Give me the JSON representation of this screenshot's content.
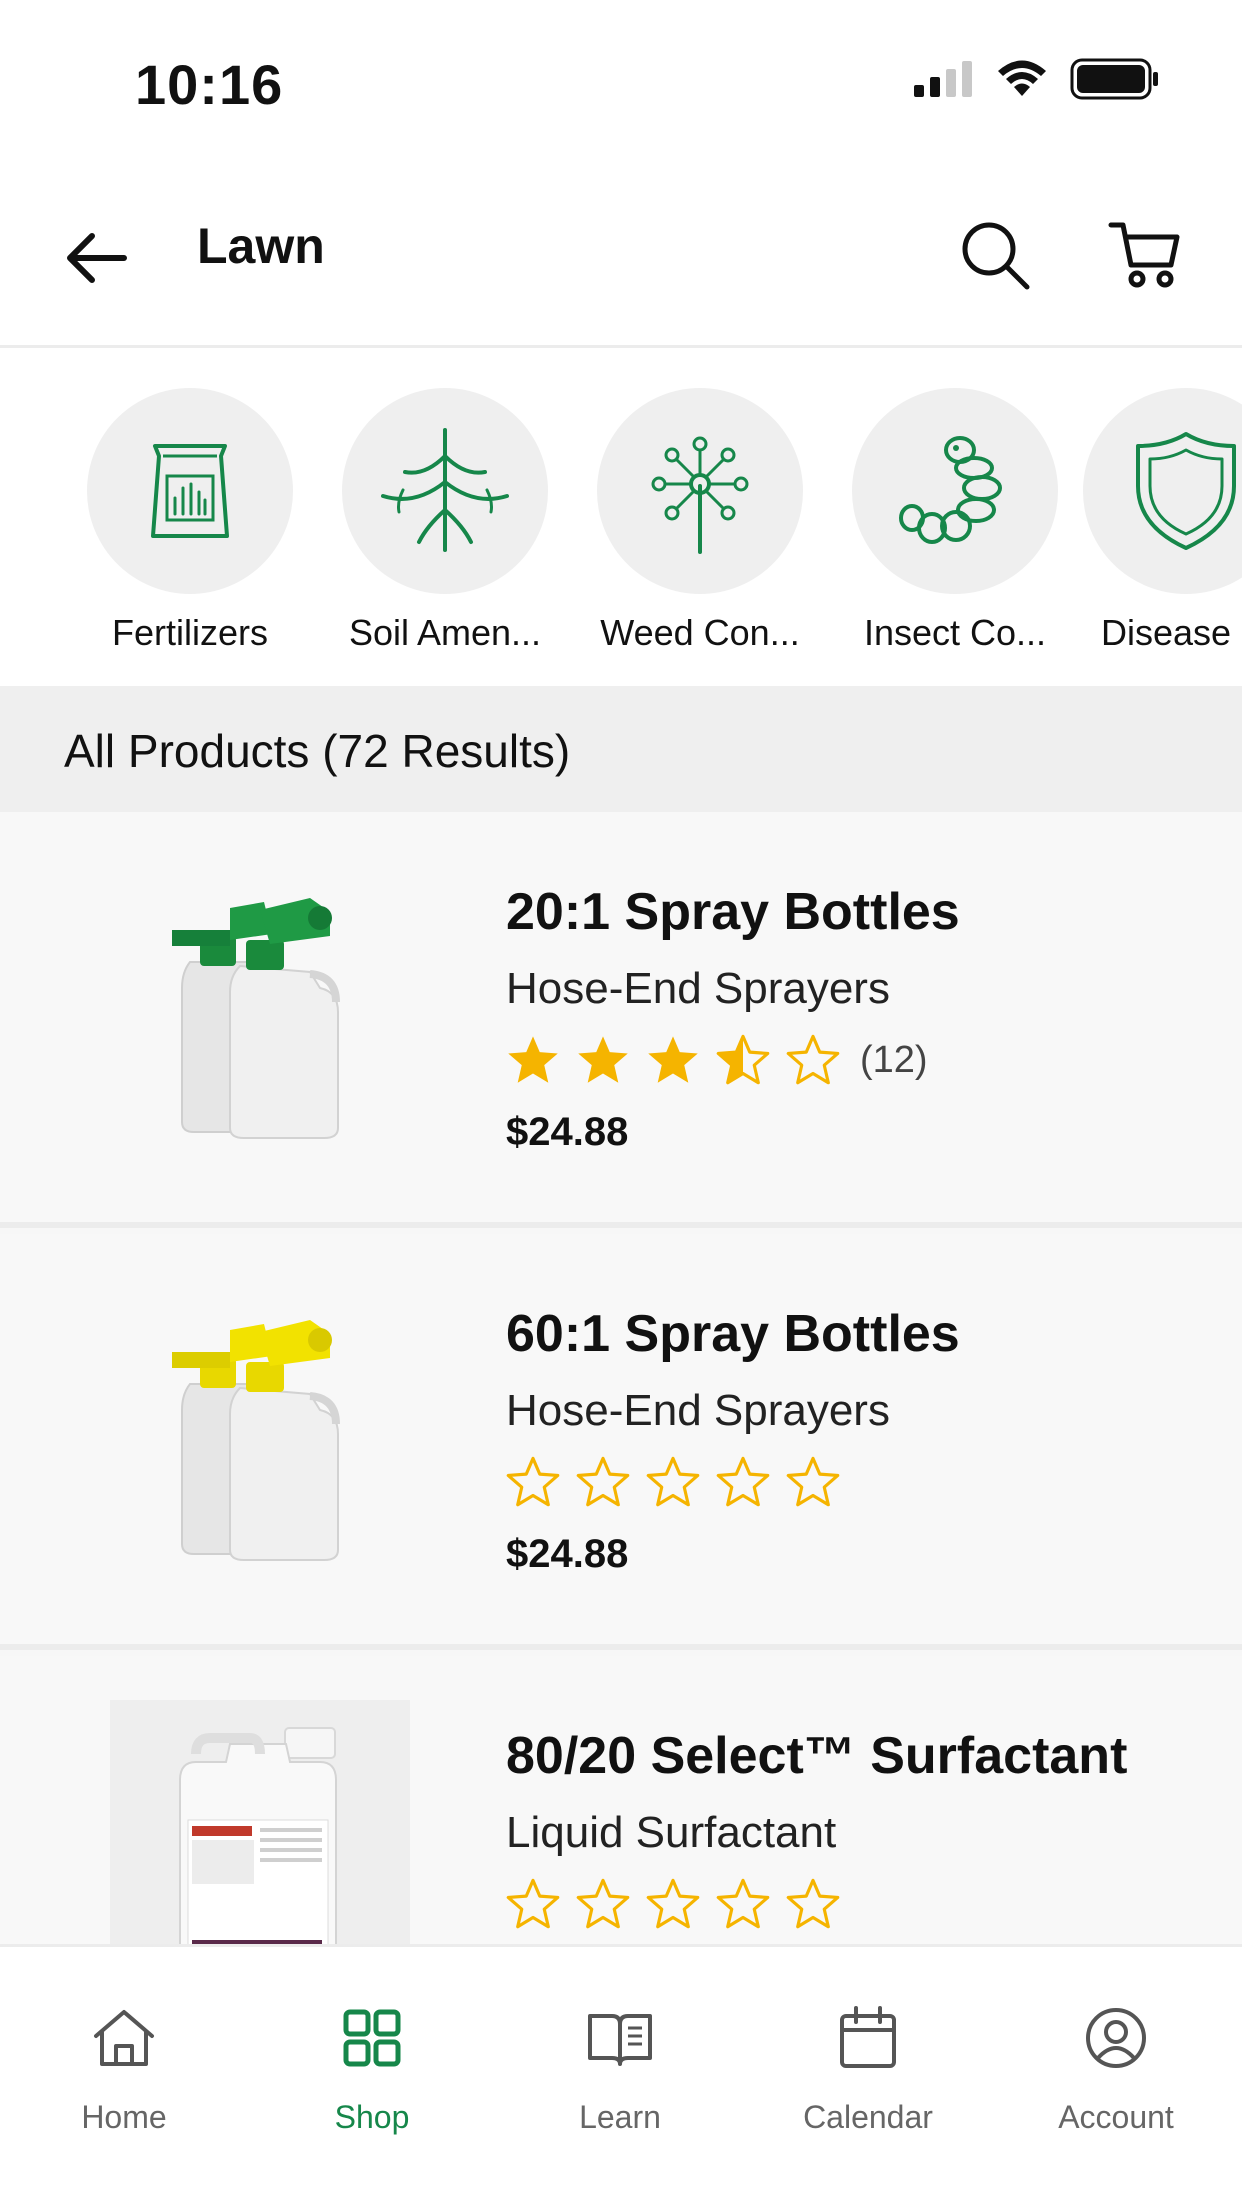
{
  "status_bar": {
    "time": "10:16"
  },
  "header": {
    "title": "Lawn"
  },
  "categories": [
    {
      "label": "Fertilizers",
      "icon": "fertilizer-bag-icon"
    },
    {
      "label": "Soil Amen...",
      "icon": "roots-icon"
    },
    {
      "label": "Weed Con...",
      "icon": "dandelion-icon"
    },
    {
      "label": "Insect Co...",
      "icon": "grub-icon"
    },
    {
      "label": "Disease",
      "icon": "shield-icon"
    }
  ],
  "results": {
    "label": "All Products (72 Results)"
  },
  "products": [
    {
      "name": "20:1 Spray Bottles",
      "subtitle": "Hose-End Sprayers",
      "rating": 3.5,
      "reviews": "(12)",
      "price": "$24.88",
      "nozzle_color": "#1a8a3c"
    },
    {
      "name": "60:1 Spray Bottles",
      "subtitle": "Hose-End Sprayers",
      "rating": 0,
      "reviews": "",
      "price": "$24.88",
      "nozzle_color": "#f2e200"
    },
    {
      "name": "80/20 Select™ Surfactant",
      "subtitle": "Liquid Surfactant",
      "rating": 0,
      "reviews": "",
      "price": ""
    }
  ],
  "nav": [
    {
      "label": "Home",
      "icon": "home-icon",
      "active": false
    },
    {
      "label": "Shop",
      "icon": "grid-icon",
      "active": true
    },
    {
      "label": "Learn",
      "icon": "book-icon",
      "active": false
    },
    {
      "label": "Calendar",
      "icon": "calendar-icon",
      "active": false
    },
    {
      "label": "Account",
      "icon": "account-icon",
      "active": false
    }
  ],
  "colors": {
    "brand_green": "#16874a",
    "star": "#f5b400"
  }
}
